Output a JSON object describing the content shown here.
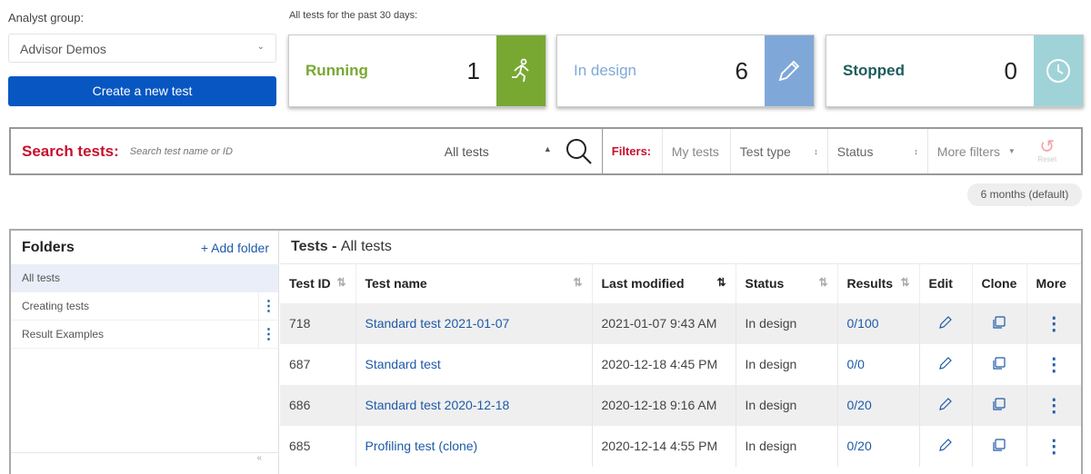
{
  "analyst_group": {
    "label": "Analyst group:",
    "value": "Advisor Demos"
  },
  "create_button": "Create a new test",
  "summary": {
    "label": "All tests for the past 30 days:",
    "cards": [
      {
        "name": "Running",
        "count": "1",
        "color": "#78a832",
        "icon": "running-icon",
        "icon_bg": "#78a832"
      },
      {
        "name": "In design",
        "count": "6",
        "color": "#7fa8d8",
        "icon": "pencil-icon",
        "icon_bg": "#7fa8d8"
      },
      {
        "name": "Stopped",
        "count": "0",
        "color": "#1f5c5c",
        "icon": "clock-icon",
        "icon_bg": "#9fd3d8"
      }
    ]
  },
  "search": {
    "label": "Search tests:",
    "placeholder": "Search test name or ID",
    "scope": "All tests"
  },
  "filters": {
    "label": "Filters:",
    "my_tests": "My tests",
    "test_type": "Test type",
    "status": "Status",
    "more": "More filters",
    "reset": "Reset"
  },
  "date_range": "6 months (default)",
  "folders": {
    "title": "Folders",
    "add": "+ Add folder",
    "items": [
      "All tests",
      "Creating tests",
      "Result Examples"
    ]
  },
  "tests": {
    "title": "Tests",
    "subtitle": "All tests",
    "columns": [
      "Test ID",
      "Test name",
      "Last modified",
      "Status",
      "Results",
      "Edit",
      "Clone",
      "More"
    ],
    "rows": [
      {
        "id": "718",
        "name": "Standard test 2021-01-07",
        "modified": "2021-01-07 9:43 AM",
        "status": "In design",
        "results": "0/100"
      },
      {
        "id": "687",
        "name": "Standard test",
        "modified": "2020-12-18 4:45 PM",
        "status": "In design",
        "results": "0/0"
      },
      {
        "id": "686",
        "name": "Standard test 2020-12-18",
        "modified": "2020-12-18 9:16 AM",
        "status": "In design",
        "results": "0/20"
      },
      {
        "id": "685",
        "name": "Profiling test (clone)",
        "modified": "2020-12-14 4:55 PM",
        "status": "In design",
        "results": "0/20"
      }
    ]
  }
}
